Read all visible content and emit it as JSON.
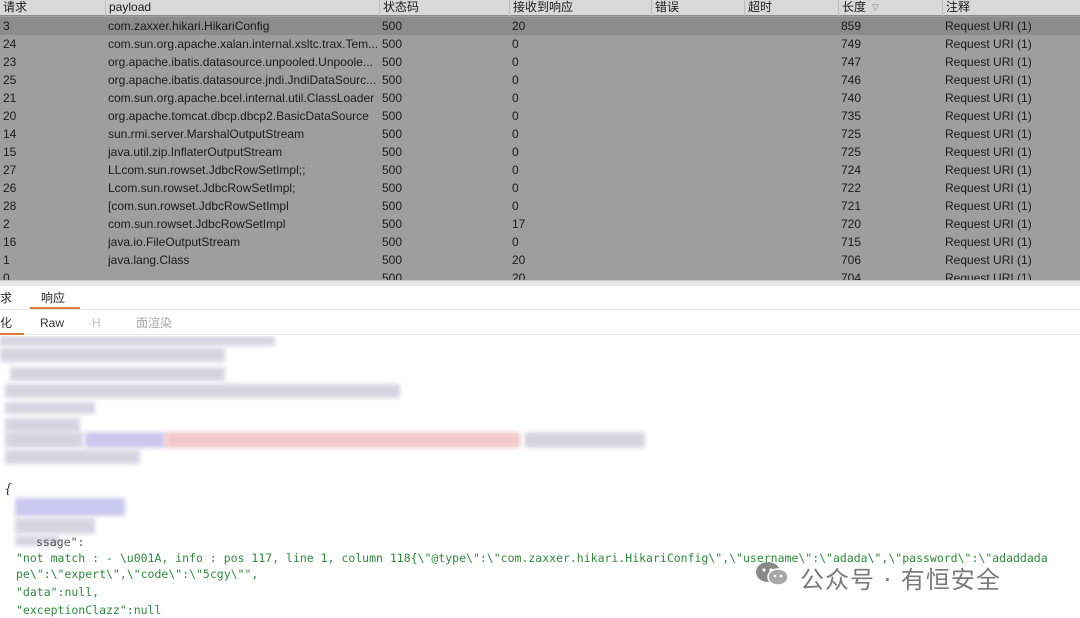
{
  "table": {
    "headers": {
      "request": "请求",
      "payload": "payload",
      "status": "状态码",
      "received": "接收到响应",
      "error": "错误",
      "timeout": "超时",
      "length": "长度",
      "comment": "注释"
    },
    "rows": [
      {
        "request": "3",
        "payload": "com.zaxxer.hikari.HikariConfig",
        "status": "500",
        "received": "20",
        "error": "",
        "timeout": "",
        "length": "859",
        "comment": "Request URI (1)"
      },
      {
        "request": "24",
        "payload": "com.sun.org.apache.xalan.internal.xsltc.trax.Tem...",
        "status": "500",
        "received": "0",
        "error": "",
        "timeout": "",
        "length": "749",
        "comment": "Request URI (1)"
      },
      {
        "request": "23",
        "payload": "org.apache.ibatis.datasource.unpooled.Unpoole...",
        "status": "500",
        "received": "0",
        "error": "",
        "timeout": "",
        "length": "747",
        "comment": "Request URI (1)"
      },
      {
        "request": "25",
        "payload": "org.apache.ibatis.datasource.jndi.JndiDataSourc...",
        "status": "500",
        "received": "0",
        "error": "",
        "timeout": "",
        "length": "746",
        "comment": "Request URI (1)"
      },
      {
        "request": "21",
        "payload": "com.sun.org.apache.bcel.internal.util.ClassLoader",
        "status": "500",
        "received": "0",
        "error": "",
        "timeout": "",
        "length": "740",
        "comment": "Request URI (1)"
      },
      {
        "request": "20",
        "payload": "org.apache.tomcat.dbcp.dbcp2.BasicDataSource",
        "status": "500",
        "received": "0",
        "error": "",
        "timeout": "",
        "length": "735",
        "comment": "Request URI (1)"
      },
      {
        "request": "14",
        "payload": "sun.rmi.server.MarshalOutputStream",
        "status": "500",
        "received": "0",
        "error": "",
        "timeout": "",
        "length": "725",
        "comment": "Request URI (1)"
      },
      {
        "request": "15",
        "payload": "java.util.zip.InflaterOutputStream",
        "status": "500",
        "received": "0",
        "error": "",
        "timeout": "",
        "length": "725",
        "comment": "Request URI (1)"
      },
      {
        "request": "27",
        "payload": "LLcom.sun.rowset.JdbcRowSetImpl;;",
        "status": "500",
        "received": "0",
        "error": "",
        "timeout": "",
        "length": "724",
        "comment": "Request URI (1)"
      },
      {
        "request": "26",
        "payload": "Lcom.sun.rowset.JdbcRowSetImpl;",
        "status": "500",
        "received": "0",
        "error": "",
        "timeout": "",
        "length": "722",
        "comment": "Request URI (1)"
      },
      {
        "request": "28",
        "payload": "[com.sun.rowset.JdbcRowSetImpl",
        "status": "500",
        "received": "0",
        "error": "",
        "timeout": "",
        "length": "721",
        "comment": "Request URI (1)"
      },
      {
        "request": "2",
        "payload": "com.sun.rowset.JdbcRowSetImpl",
        "status": "500",
        "received": "17",
        "error": "",
        "timeout": "",
        "length": "720",
        "comment": "Request URI (1)"
      },
      {
        "request": "16",
        "payload": "java.io.FileOutputStream",
        "status": "500",
        "received": "0",
        "error": "",
        "timeout": "",
        "length": "715",
        "comment": "Request URI (1)"
      },
      {
        "request": "1",
        "payload": "java.lang.Class",
        "status": "500",
        "received": "20",
        "error": "",
        "timeout": "",
        "length": "706",
        "comment": "Request URI (1)"
      },
      {
        "request": "0",
        "payload": "",
        "status": "500",
        "received": "20",
        "error": "",
        "timeout": "",
        "length": "704",
        "comment": "Request URI (1)"
      }
    ]
  },
  "tabs": {
    "request": "求",
    "response": "响应"
  },
  "subtabs": {
    "pretty": "化",
    "raw": "Raw",
    "headers": "·H",
    "render": "面渲染"
  },
  "response_body": {
    "brace": "{",
    "message_key": "ssage\":",
    "message_value": "\"not match : - \\u001A, info : pos 117, line 1, column 118{\\\"@type\\\":\\\"com.zaxxer.hikari.HikariConfig\\\",\\\"username\\\":\\\"adada\\\",\\\"password\\\":\\\"adaddada",
    "message_cont": "pe\\\":\\\"expert\\\",\\\"code\\\":\\\"5cgy\\\"\",",
    "data_line": "\"data\":null,",
    "exception_line": "\"exceptionClazz\":null"
  },
  "watermark": {
    "text": "公众号 · 有恒安全",
    "icon": "wechat-icon"
  },
  "colors": {
    "table_bg": "#9e9e9e",
    "header_bg": "#d9d9d9",
    "active_tab": "#e07a3c",
    "json_text": "#2f8a3c"
  }
}
